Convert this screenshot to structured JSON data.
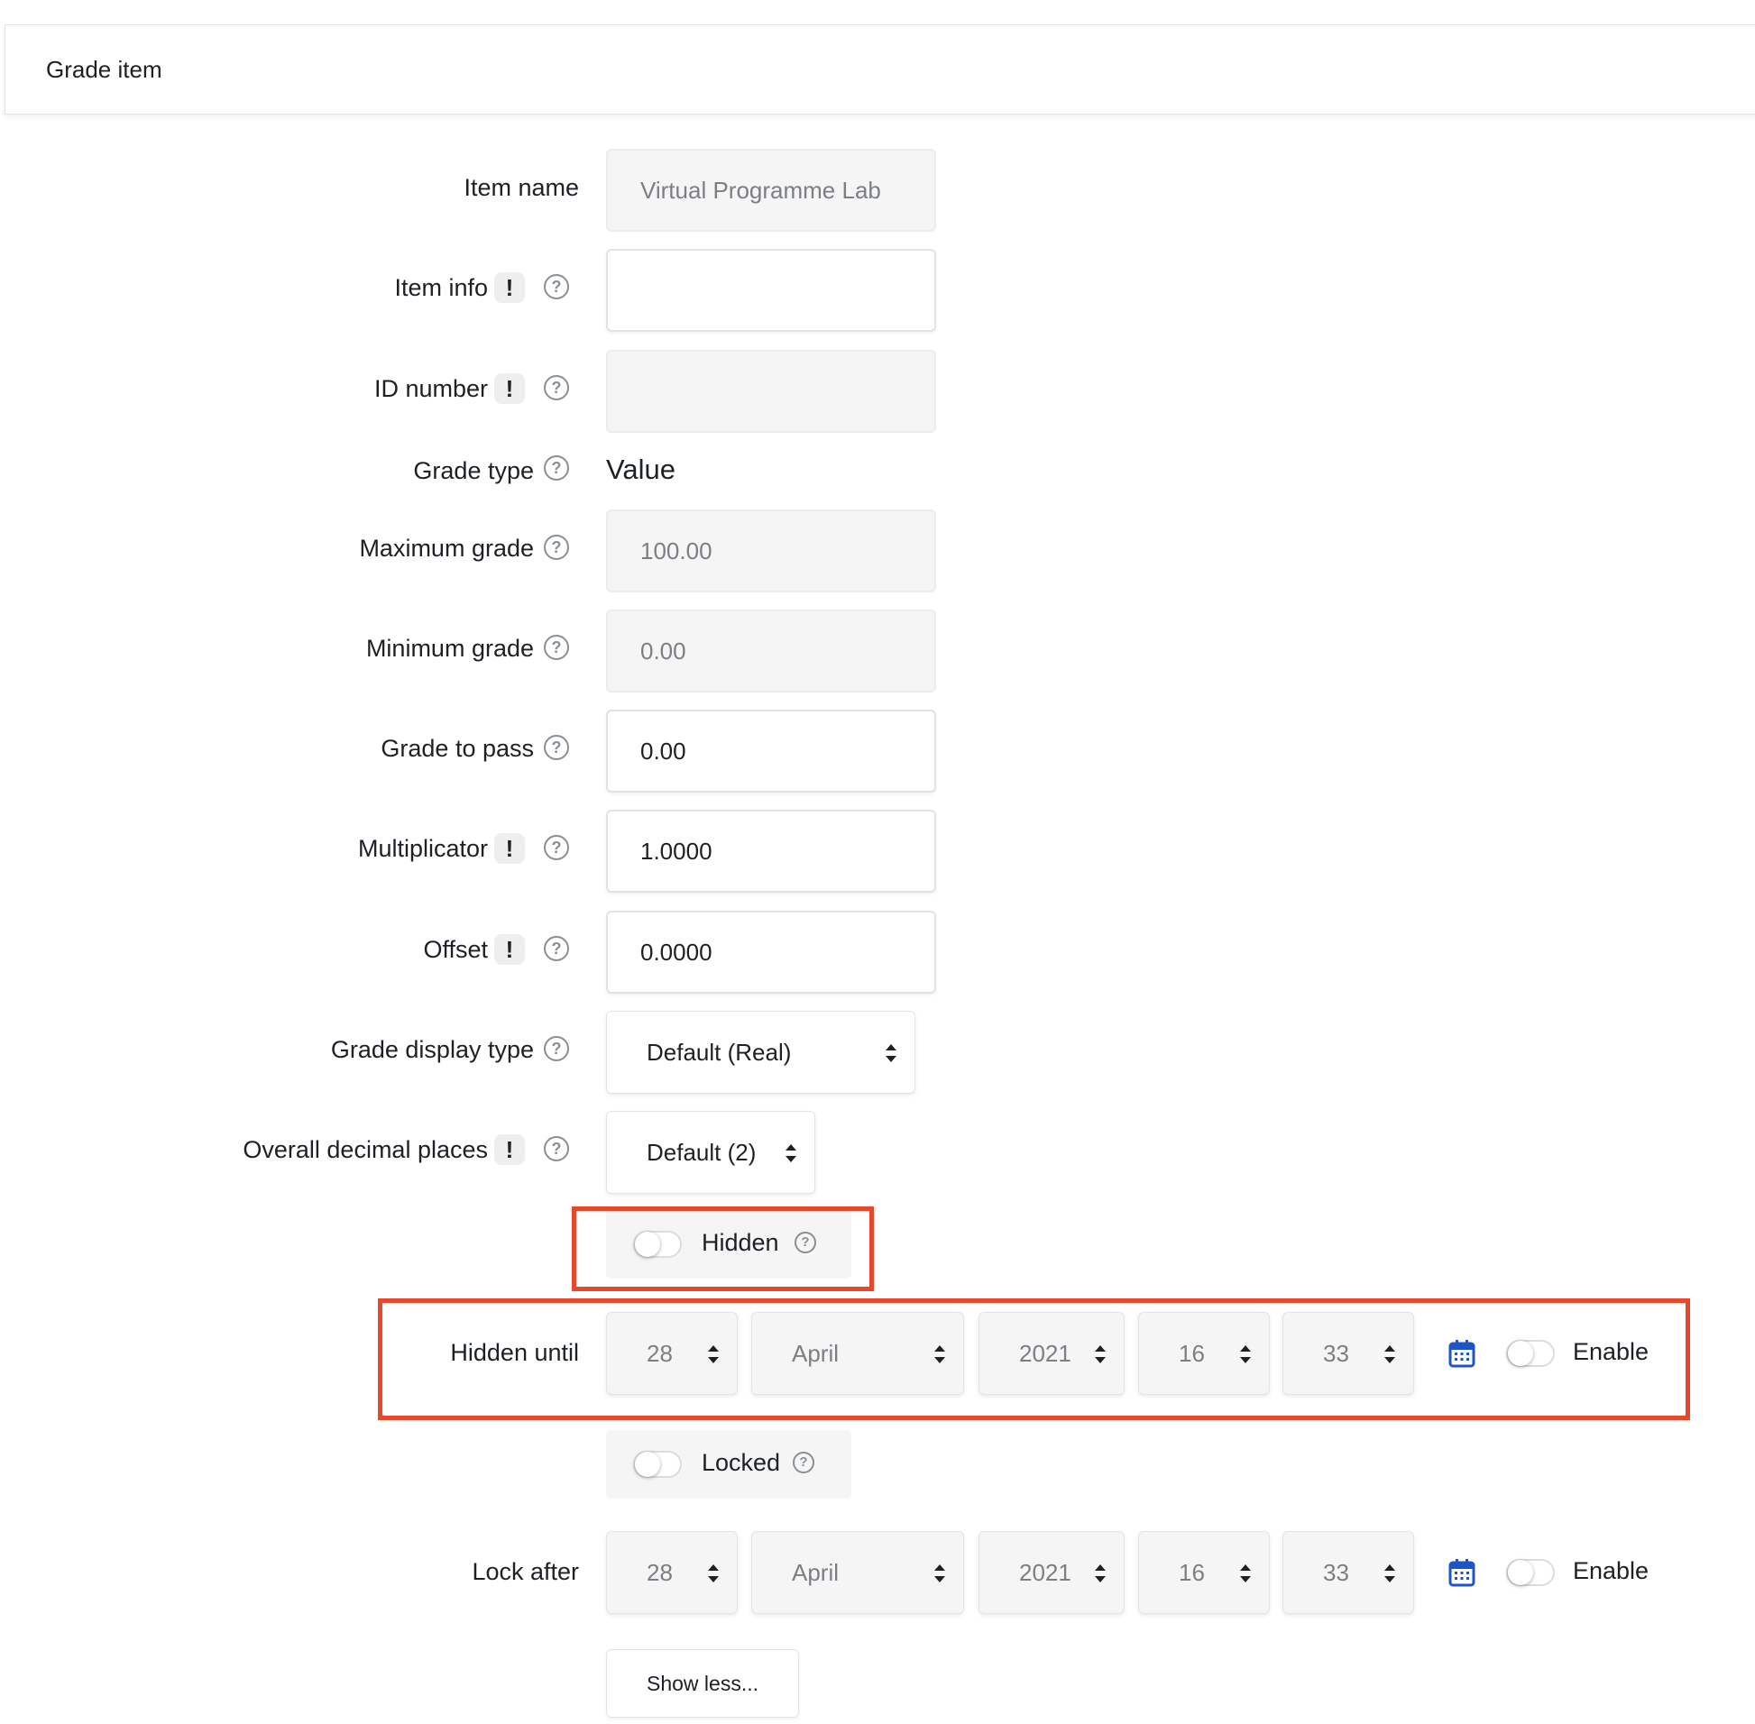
{
  "header": {
    "title": "Grade item"
  },
  "fields": {
    "item_name": {
      "label": "Item name",
      "value": "Virtual Programme Lab"
    },
    "item_info": {
      "label": "Item info",
      "value": ""
    },
    "id_number": {
      "label": "ID number",
      "value": ""
    },
    "grade_type": {
      "label": "Grade type",
      "value": "Value"
    },
    "max_grade": {
      "label": "Maximum grade",
      "value": "100.00"
    },
    "min_grade": {
      "label": "Minimum grade",
      "value": "0.00"
    },
    "grade_to_pass": {
      "label": "Grade to pass",
      "value": "0.00"
    },
    "multiplicator": {
      "label": "Multiplicator",
      "value": "1.0000"
    },
    "offset": {
      "label": "Offset",
      "value": "0.0000"
    },
    "grade_display_type": {
      "label": "Grade display type",
      "selected": "Default (Real)"
    },
    "decimal_places": {
      "label": "Overall decimal places",
      "selected": "Default (2)"
    }
  },
  "hidden_toggle": {
    "label": "Hidden",
    "checked": false
  },
  "hidden_until": {
    "label": "Hidden until",
    "day": "28",
    "month": "April",
    "year": "2021",
    "hour": "16",
    "minute": "33",
    "enable_label": "Enable",
    "enabled": false
  },
  "locked_toggle": {
    "label": "Locked",
    "checked": false
  },
  "lock_after": {
    "label": "Lock after",
    "day": "28",
    "month": "April",
    "year": "2021",
    "hour": "16",
    "minute": "33",
    "enable_label": "Enable",
    "enabled": false
  },
  "show_less_button": {
    "label": "Show less..."
  },
  "icons": {
    "required": "!",
    "help": "?"
  },
  "colors": {
    "highlight": "#e8472c",
    "calendar": "#1f54c7"
  }
}
